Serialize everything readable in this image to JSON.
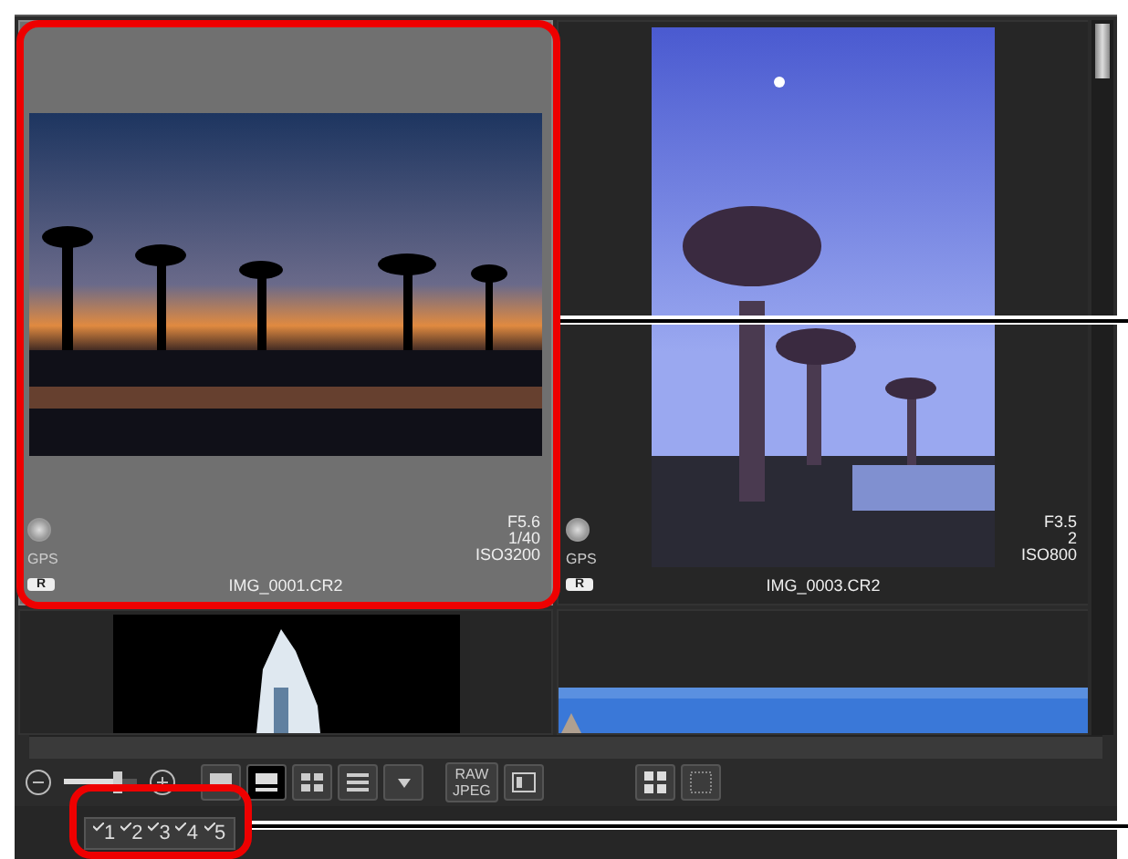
{
  "thumbnails": [
    {
      "filename": "IMG_0001.CR2",
      "aperture": "F5.6",
      "shutter": "1/40",
      "iso": "ISO3200",
      "gps": "GPS",
      "badge": "R",
      "selected": true
    },
    {
      "filename": "IMG_0003.CR2",
      "aperture": "F3.5",
      "shutter": "2",
      "iso": "ISO800",
      "gps": "GPS",
      "badge": "R",
      "selected": false
    },
    {
      "selected": false
    },
    {
      "selected": false
    }
  ],
  "view_modes": [
    {
      "selected": false
    },
    {
      "selected": true
    },
    {
      "selected": false
    },
    {
      "selected": false
    }
  ],
  "zoom_slider": {
    "level": 0.75
  },
  "raw_button": {
    "top": "RAW",
    "bottom": "JPEG"
  },
  "ratings": [
    {
      "label": "1"
    },
    {
      "label": "2"
    },
    {
      "label": "3"
    },
    {
      "label": "4"
    },
    {
      "label": "5"
    }
  ]
}
